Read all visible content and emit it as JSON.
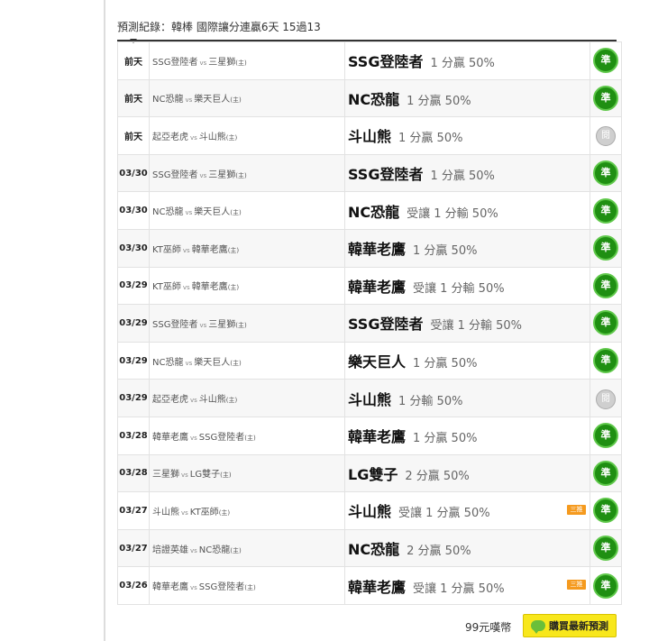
{
  "header": {
    "title": "預測紀錄：韓棒 國際讓分連贏6天 15過13"
  },
  "icons": {
    "hit": "check-badge-icon",
    "push": "push-badge-icon",
    "buy": "chat-bubble-icon"
  },
  "colors": {
    "hit": "#1f8f12",
    "push": "#cfcfcf",
    "badge": "#f59a1e",
    "buy_button": "#f8e71c"
  },
  "rows": [
    {
      "date": "前天",
      "away": "SSG登陸者",
      "vs": "vs",
      "home": "三星獅",
      "home_tag": "(主)",
      "team": "SSG登陸者",
      "odds": "1 分贏 50%",
      "badge": "",
      "result": "準",
      "status": "hit"
    },
    {
      "date": "前天",
      "away": "NC恐龍",
      "vs": "vs",
      "home": "樂天巨人",
      "home_tag": "(主)",
      "team": "NC恐龍",
      "odds": "1 分贏 50%",
      "badge": "",
      "result": "準",
      "status": "hit"
    },
    {
      "date": "前天",
      "away": "起亞老虎",
      "vs": "vs",
      "home": "斗山熊",
      "home_tag": "(主)",
      "team": "斗山熊",
      "odds": "1 分贏 50%",
      "badge": "",
      "result": "閱",
      "status": "push"
    },
    {
      "date": "03/30",
      "away": "SSG登陸者",
      "vs": "vs",
      "home": "三星獅",
      "home_tag": "(主)",
      "team": "SSG登陸者",
      "odds": "1 分贏 50%",
      "badge": "",
      "result": "準",
      "status": "hit"
    },
    {
      "date": "03/30",
      "away": "NC恐龍",
      "vs": "vs",
      "home": "樂天巨人",
      "home_tag": "(主)",
      "team": "NC恐龍",
      "odds": "受讓 1 分輸 50%",
      "badge": "",
      "result": "準",
      "status": "hit"
    },
    {
      "date": "03/30",
      "away": "KT巫師",
      "vs": "vs",
      "home": "韓華老鷹",
      "home_tag": "(主)",
      "team": "韓華老鷹",
      "odds": "1 分贏 50%",
      "badge": "",
      "result": "準",
      "status": "hit"
    },
    {
      "date": "03/29",
      "away": "KT巫師",
      "vs": "vs",
      "home": "韓華老鷹",
      "home_tag": "(主)",
      "team": "韓華老鷹",
      "odds": "受讓 1 分輸 50%",
      "badge": "",
      "result": "準",
      "status": "hit"
    },
    {
      "date": "03/29",
      "away": "SSG登陸者",
      "vs": "vs",
      "home": "三星獅",
      "home_tag": "(主)",
      "team": "SSG登陸者",
      "odds": "受讓 1 分輸 50%",
      "badge": "",
      "result": "準",
      "status": "hit"
    },
    {
      "date": "03/29",
      "away": "NC恐龍",
      "vs": "vs",
      "home": "樂天巨人",
      "home_tag": "(主)",
      "team": "樂天巨人",
      "odds": "1 分贏 50%",
      "badge": "",
      "result": "準",
      "status": "hit"
    },
    {
      "date": "03/29",
      "away": "起亞老虎",
      "vs": "vs",
      "home": "斗山熊",
      "home_tag": "(主)",
      "team": "斗山熊",
      "odds": "1 分輸 50%",
      "badge": "",
      "result": "閱",
      "status": "push"
    },
    {
      "date": "03/28",
      "away": "韓華老鷹",
      "vs": "vs",
      "home": "SSG登陸者",
      "home_tag": "(主)",
      "team": "韓華老鷹",
      "odds": "1 分贏 50%",
      "badge": "",
      "result": "準",
      "status": "hit"
    },
    {
      "date": "03/28",
      "away": "三星獅",
      "vs": "vs",
      "home": "LG雙子",
      "home_tag": "(主)",
      "team": "LG雙子",
      "odds": "2 分贏 50%",
      "badge": "",
      "result": "準",
      "status": "hit"
    },
    {
      "date": "03/27",
      "away": "斗山熊",
      "vs": "vs",
      "home": "KT巫師",
      "home_tag": "(主)",
      "team": "斗山熊",
      "odds": "受讓 1 分贏 50%",
      "badge": "三推",
      "result": "準",
      "status": "hit"
    },
    {
      "date": "03/27",
      "away": "培證英雄",
      "vs": "vs",
      "home": "NC恐龍",
      "home_tag": "(主)",
      "team": "NC恐龍",
      "odds": "2 分贏 50%",
      "badge": "",
      "result": "準",
      "status": "hit"
    },
    {
      "date": "03/26",
      "away": "韓華老鷹",
      "vs": "vs",
      "home": "SSG登陸者",
      "home_tag": "(主)",
      "team": "韓華老鷹",
      "odds": "受讓 1 分贏 50%",
      "badge": "三推",
      "result": "準",
      "status": "hit"
    }
  ],
  "footer": {
    "price": "99元嘆幣",
    "buy_label": "購買最新預測"
  }
}
